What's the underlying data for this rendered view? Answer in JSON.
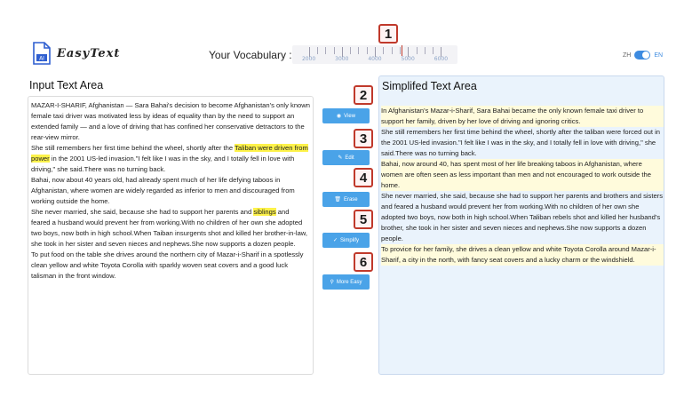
{
  "app": {
    "name": "EasyText"
  },
  "vocab": {
    "label": "Your Vocabulary :",
    "ticks": [
      "2000",
      "3000",
      "4000",
      "5000",
      "6000"
    ],
    "level": 4800
  },
  "lang": {
    "zh": "ZH",
    "en": "EN",
    "selected": "EN"
  },
  "badges": [
    "1",
    "2",
    "3",
    "4",
    "5",
    "6"
  ],
  "input": {
    "title": "Input Text Area",
    "paragraphs": [
      {
        "pre": "",
        "text": "MAZAR-I-SHARIF, Afghanistan — Sara Bahai's decision to become Afghanistan's only known female taxi driver was motivated less by ideas of equality than by the need to support an extended family — and a love of driving that has confined her conservative detractors to the rear-view mirror.",
        "mark": ""
      },
      {
        "pre": "She still remembers her first time behind the wheel, shortly after the ",
        "mark": "Taliban were driven from power",
        "text": " in the 2001 US-led invasion.\"I felt like I was in the sky, and I totally fell in love with driving,\" she said.There was no turning back."
      },
      {
        "pre": "",
        "text": "Bahai, now about 40 years old, had already spent much of her life defying taboos in Afghanistan, where women are widely regarded as inferior to men and discouraged from working outside the home.",
        "mark": ""
      },
      {
        "pre": "She never married, she said, because she had to support her parents and ",
        "mark": "siblings",
        "text": " and feared a husband would prevent her from working.With no children of her own she adopted two boys, now both in high school.When Taiban insurgents shot and killed her brother-in-law, she took in her sister and seven nieces and nephews.She now supports a dozen people."
      },
      {
        "pre": "",
        "text": "To put food on the table she drives around the northern city of Mazar-i-Sharif in a spotlessly clean yellow and white Toyota Corolla with sparkly woven seat covers and a good luck talisman in the front window.",
        "mark": ""
      }
    ]
  },
  "output": {
    "title": "Simplifed Text Area",
    "paragraphs": [
      "In Afghanistan's Mazar-i-Sharif, Sara Bahai became the only known female taxi driver to support her family, driven by her love of driving and ignoring critics.",
      "She still remembers her first time behind the wheel, shortly after the taliban were forced out in the 2001 US-led invasion.\"I felt like I was in the sky, and I totally fell in love with driving,\" she said.There was no turning back.",
      "Bahai, now around 40, has spent most of her life breaking taboos in Afghanistan, where women are often seen as less important than men and not encouraged to work outside the home.",
      "She never married, she said, because she had to support her parents and brothers and sisters and feared a husband would prevent her from working.With no children of her own she adopted two boys, now both in high school.When Taliban rebels shot and killed her husband's brother, she took in her sister and seven nieces and nephews.She now supports a dozen people.",
      "To provice for her family, she drives a clean yellow and white Toyota Corolla around Mazar-i-Sharif, a city in the north, with fancy seat covers and a lucky charm or the windshield."
    ]
  },
  "buttons": [
    {
      "label": "View",
      "icon": "eye-icon",
      "glyph": "◉"
    },
    {
      "label": "Edit",
      "icon": "edit-icon",
      "glyph": "✎"
    },
    {
      "label": "Erase",
      "icon": "trash-icon",
      "glyph": "🗑"
    },
    {
      "label": "Simplify",
      "icon": "check-icon",
      "glyph": "✓"
    },
    {
      "label": "More Easy",
      "icon": "search-icon",
      "glyph": "⚲"
    }
  ],
  "colors": {
    "accent": "#4aa3e8",
    "highlight": "#fdf24a",
    "badge_border": "#c0392b"
  }
}
